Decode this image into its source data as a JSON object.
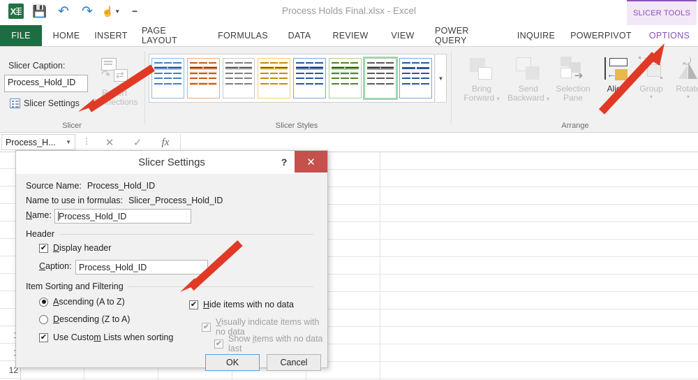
{
  "window": {
    "document_title": "Process Holds Final.xlsx - Excel",
    "contextual_tab_group": "SLICER TOOLS"
  },
  "quick_access": [
    {
      "name": "excel-logo",
      "label": "X"
    },
    {
      "name": "save-icon",
      "glyph": "💾"
    },
    {
      "name": "undo-icon",
      "glyph": "↶"
    },
    {
      "name": "redo-icon",
      "glyph": "↷"
    },
    {
      "name": "touch-mode-icon",
      "glyph": "☝"
    },
    {
      "name": "customize-qat-icon",
      "glyph": "‒"
    }
  ],
  "ribbon_tabs": [
    {
      "label": "FILE",
      "active": false
    },
    {
      "label": "HOME",
      "active": false
    },
    {
      "label": "INSERT",
      "active": false
    },
    {
      "label": "PAGE LAYOUT",
      "active": false
    },
    {
      "label": "FORMULAS",
      "active": false
    },
    {
      "label": "DATA",
      "active": false
    },
    {
      "label": "REVIEW",
      "active": false
    },
    {
      "label": "VIEW",
      "active": false
    },
    {
      "label": "POWER QUERY",
      "active": false
    },
    {
      "label": "INQUIRE",
      "active": false
    },
    {
      "label": "POWERPIVOT",
      "active": false
    },
    {
      "label": "OPTIONS",
      "active": true
    }
  ],
  "ribbon": {
    "slicer_group": {
      "group_label": "Slicer",
      "caption_label": "Slicer Caption:",
      "caption_value": "Process_Hold_ID",
      "slicer_settings_label": "Slicer Settings",
      "report_connections_line1": "Report",
      "report_connections_line2": "Connections"
    },
    "styles_group": {
      "group_label": "Slicer Styles",
      "selected_index": 6,
      "swatches": [
        {
          "name": "style-light-blue",
          "border": "#8fb9e0",
          "accent": "#9dc3e6",
          "fill": "#dbe9f7",
          "line": "#4a7ebb"
        },
        {
          "name": "style-light-orange",
          "border": "#eda87e",
          "accent": "#f4b183",
          "fill": "#fce4d6",
          "line": "#c55a11"
        },
        {
          "name": "style-light-gray",
          "border": "#c9c9c9",
          "accent": "#cfcfcf",
          "fill": "#ededed",
          "line": "#7f7f7f"
        },
        {
          "name": "style-light-yellow",
          "border": "#f3d06a",
          "accent": "#ffd966",
          "fill": "#fff2cc",
          "line": "#bf9000"
        },
        {
          "name": "style-medium-blue",
          "border": "#7ba7d7",
          "accent": "#8faadc",
          "fill": "#ffffff",
          "line": "#2f5597"
        },
        {
          "name": "style-light-green",
          "border": "#a9cf96",
          "accent": "#a9d18e",
          "fill": "#e2f0d9",
          "line": "#548235"
        },
        {
          "name": "style-dark-gray-selected",
          "border": "#909090",
          "accent": "#a6a6a6",
          "fill": "#ffffff",
          "line": "#595959"
        },
        {
          "name": "style-blue-dark",
          "border": "#7ba7d7",
          "accent": "#2f5597",
          "fill": "#ffffff",
          "line": "#2f5597"
        }
      ],
      "more_styles_glyph": "▼"
    },
    "arrange_group": {
      "group_label": "Arrange",
      "buttons": [
        {
          "name": "bring-forward-button",
          "line1": "Bring",
          "line2": "Forward",
          "dropdown": true,
          "enabled": false
        },
        {
          "name": "send-backward-button",
          "line1": "Send",
          "line2": "Backward",
          "dropdown": true,
          "enabled": false
        },
        {
          "name": "selection-pane-button",
          "line1": "Selection",
          "line2": "Pane",
          "dropdown": false,
          "enabled": false
        },
        {
          "name": "align-button",
          "line1": "Align",
          "line2": "",
          "dropdown": true,
          "enabled": true
        },
        {
          "name": "group-button",
          "line1": "Group",
          "line2": "",
          "dropdown": true,
          "enabled": false
        },
        {
          "name": "rotate-button",
          "line1": "Rotate",
          "line2": "",
          "dropdown": true,
          "enabled": false
        }
      ]
    }
  },
  "formula_bar": {
    "name_box_value": "Process_H...",
    "name_box_caret": "▼",
    "cancel_glyph": "✕",
    "enter_glyph": "✓",
    "function_glyph": "fx",
    "formula_value": ""
  },
  "sheet": {
    "row_headers": [
      "",
      "",
      "",
      "",
      "",
      "",
      "",
      "",
      "",
      "",
      "",
      "1",
      "1",
      "12"
    ],
    "visible_row_labels_bottom": [
      "1",
      "1",
      "12"
    ]
  },
  "dialog": {
    "title": "Slicer Settings",
    "help_glyph": "?",
    "close_glyph": "✕",
    "source_name_label": "Source Name:",
    "source_name_value": "Process_Hold_ID",
    "formula_name_label": "Name to use in formulas:",
    "formula_name_value": "Slicer_Process_Hold_ID",
    "name_label": "Name:",
    "name_value": "Process_Hold_ID",
    "header_group_label": "Header",
    "display_header_label": "Display header",
    "display_header_checked": true,
    "caption_label": "Caption:",
    "caption_value": "Process_Hold_ID",
    "sorting_group_label": "Item Sorting and Filtering",
    "ascending_label": "Ascending (A to Z)",
    "ascending_selected": true,
    "descending_label": "Descending (Z to A)",
    "descending_selected": false,
    "custom_lists_label": "Use Custom Lists when sorting",
    "custom_lists_checked": true,
    "hide_no_data_label": "Hide items with no data",
    "hide_no_data_checked": true,
    "visually_indicate_label": "Visually indicate items with no data",
    "visually_indicate_checked": true,
    "show_last_label": "Show items with no data last",
    "show_last_checked": true,
    "ok_label": "OK",
    "cancel_label": "Cancel"
  },
  "annotations": {
    "arrow_color": "#e03a27",
    "arrows": [
      {
        "name": "arrow-to-slicer-settings",
        "points_to": "Slicer Settings"
      },
      {
        "name": "arrow-to-options-tab",
        "points_to": "OPTIONS tab"
      },
      {
        "name": "arrow-to-hide-items-checkbox",
        "points_to": "Hide items with no data"
      }
    ]
  }
}
